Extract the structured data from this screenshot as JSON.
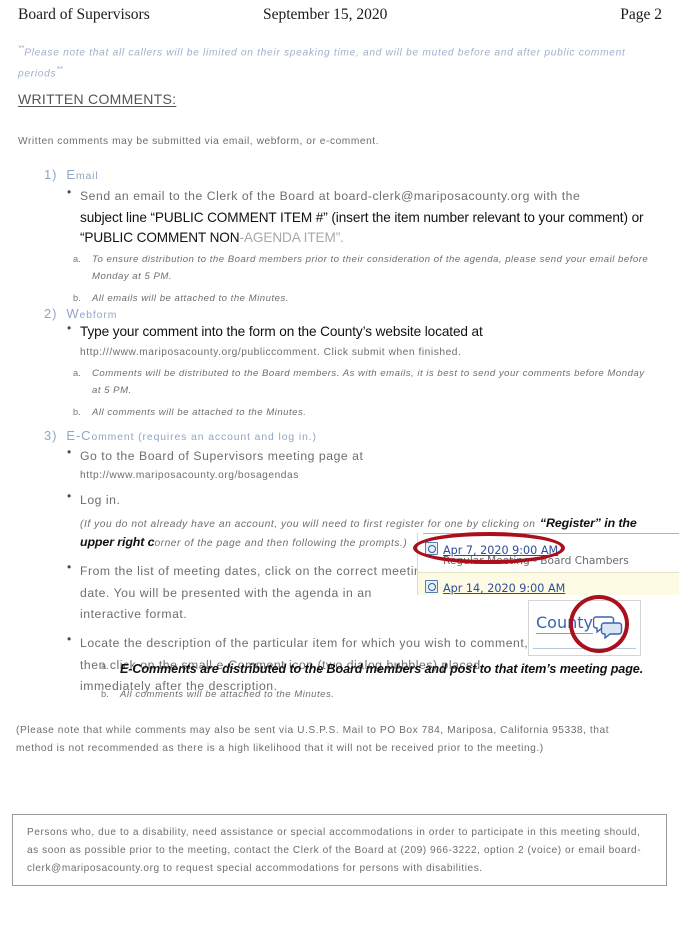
{
  "header": {
    "left": "Board of Supervisors",
    "center": "September 15, 2020",
    "right": "Page 2"
  },
  "blue_note": {
    "stars_open": "**",
    "text": "Please note that all callers will be limited on their speaking time, and will be muted before and after public comment periods",
    "stars_close": "**"
  },
  "section_title": "WRITTEN COMMENTS:",
  "intro": "Written comments may be submitted via email, webform, or e-comment.",
  "items": [
    {
      "number": "1)",
      "title_cap": "E",
      "title_rest": "mail",
      "bullets": [
        {
          "gray_lead": "Send an email to the Clerk of the Board at board-clerk@mariposacounty.org with the",
          "bold_run": "subject line “PUBLIC COMMENT ITEM #” (insert the item number relevant to your comment) or “PUBLIC COMMENT NON",
          "ghost_run": "-AGENDA ITEM”."
        }
      ],
      "subs": [
        "To ensure distribution to the Board members prior to their consideration of the agenda, please send your email before Monday at 5 PM.",
        "All emails will be attached to the Minutes."
      ]
    },
    {
      "number": "2)",
      "title_cap": "W",
      "title_rest": "ebform",
      "bullets": [
        {
          "bold_run": "Type your comment into the form on the County’s website located at",
          "gray_tail": "http:///www.mariposacounty.org/publiccomment. Click submit when finished."
        }
      ],
      "subs": [
        "Comments will be distributed to the Board members. As with emails, it is best to send your comments before Monday at 5 PM.",
        "All comments will be attached to the Minutes."
      ]
    },
    {
      "number": "3)",
      "title_cap": "E-C",
      "title_rest": "omment (requires an account and log in.)",
      "bullets": [
        {
          "gray_lead": "Go to the Board of Supervisors meeting page at",
          "gray_tail": "http://www.mariposacounty.org/bosagendas"
        },
        {
          "gray_lead": "Log in.",
          "paren_open": "(If you do not already have an account, you will need to first register for one by clicking on",
          "bold_ital": "“Register” in the upper right c",
          "paren_close": "orner of the page and then following the prompts.)"
        },
        {
          "gray_lead": "From the list of meeting dates, click on the correct meeting date. You will be presented with the agenda in an interactive format."
        },
        {
          "gray_lead": "Locate the description of the particular item for which you wish to comment, then click on the small e-Comment icon (two dialog bubbles) placed immediately after the description."
        }
      ],
      "subs_bold_first": "E-Comments are distributed to the Board members and post to that item’s meeting page.",
      "subs": [
        "All comments will be attached to the Minutes."
      ]
    }
  ],
  "usps_note": "(Please note that while comments may also be sent via U.S.P.S. Mail to PO Box 784, Mariposa, California 95338, that method is not recommended as there is a high likelihood that it will not be received prior to the meeting.)",
  "inset_dates": {
    "row1_link": "Apr 7, 2020 9:00 AM",
    "row1_sub": "Regular Meeting - Board Chambers",
    "row2_link": "Apr 14, 2020 9:00 AM"
  },
  "inset_icon": {
    "county_label": "County"
  },
  "ada_notice": "Persons who, due to a disability, need assistance or special accommodations in order to participate in this meeting should, as soon as possible prior to the meeting, contact the Clerk of the Board at (209) 966-3222, option 2 (voice) or email board-clerk@mariposacounty.org to request special accommodations for persons with disabilities.",
  "colors": {
    "blue_note": "#9fb0cc",
    "heading_blue": "#8fa6c4",
    "body_gray": "#6e6e6e",
    "annotation_red": "#ab0f1c",
    "link_blue": "#2b4d9b",
    "highlight_row": "#fdfbe4"
  }
}
